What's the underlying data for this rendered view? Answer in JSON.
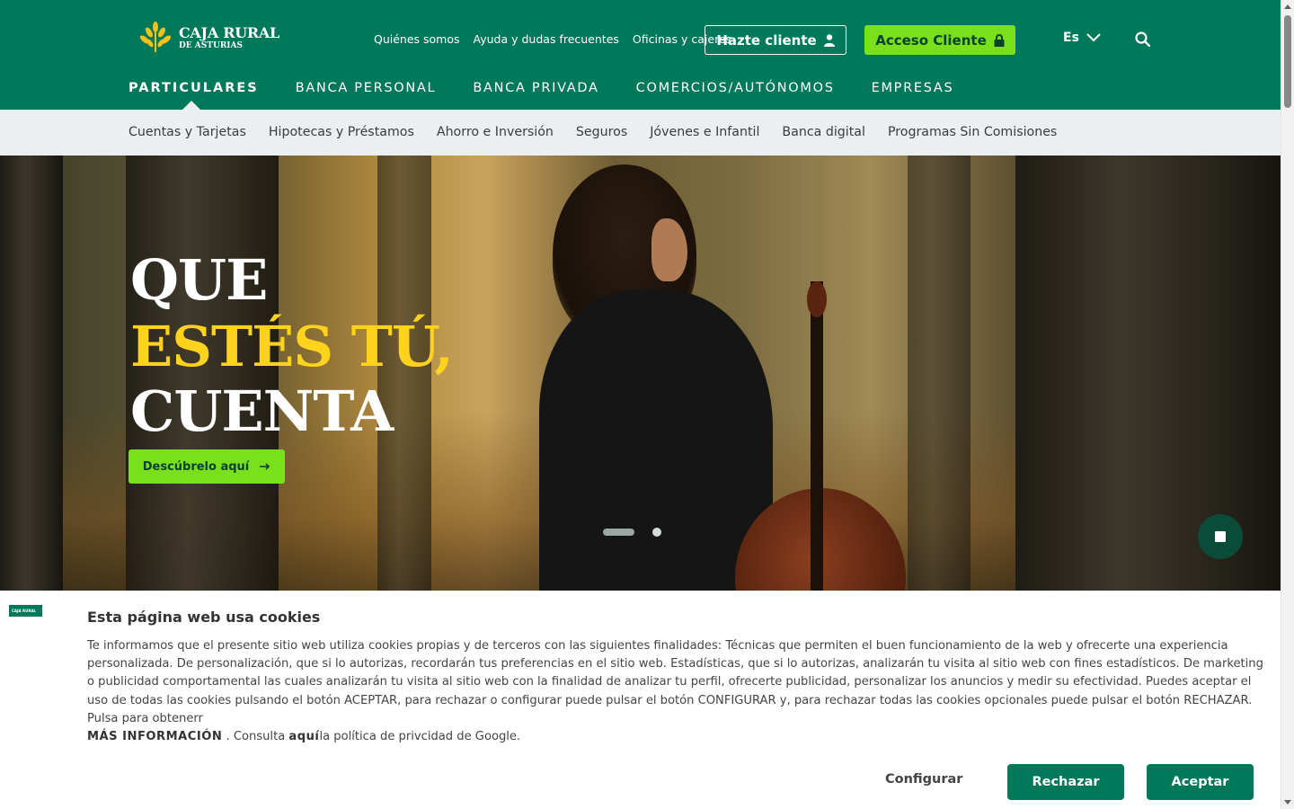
{
  "header": {
    "logo_line1": "CAJA RURAL",
    "logo_line2": "DE ASTURIAS",
    "toplinks": [
      "Quiénes somos",
      "Ayuda y dudas frecuentes",
      "Oficinas y cajeros"
    ],
    "hazte_cliente": "Hazte cliente",
    "acceso_cliente": "Acceso Cliente",
    "language": "Es",
    "brand_color": "#00785a",
    "accent_color": "#7ae01b"
  },
  "mainnav": {
    "items": [
      "PARTICULARES",
      "BANCA PERSONAL",
      "BANCA PRIVADA",
      "COMERCIOS/AUTÓNOMOS",
      "EMPRESAS"
    ],
    "active": "PARTICULARES"
  },
  "subnav": {
    "items": [
      "Cuentas y Tarjetas",
      "Hipotecas y Préstamos",
      "Ahorro e Inversión",
      "Seguros",
      "Jóvenes e Infantil",
      "Banca digital",
      "Programas Sin Comisiones"
    ]
  },
  "hero": {
    "line1": "QUE",
    "line2": "ESTÉS TÚ,",
    "line3": "CUENTA",
    "cta": "Descúbrelo aquí",
    "slides_total": 2,
    "active_slide": 1,
    "title_accent_color": "#ffd21e"
  },
  "cookie": {
    "title": "Esta página web usa cookies",
    "text": "Te informamos que el presente sitio web utiliza cookies propias y de terceros con las siguientes finalidades: Técnicas que permiten el buen funcionamiento de la web y ofrecerte una experiencia personalizada. De personalización, que si lo autorizas, recordarán tus preferencias en el sitio web. Estadísticas, que si lo autorizas, analizarán tu visita al sitio web con fines estadísticos. De marketing o publicidad comportamental las cuales analizarán tu visita al sitio web con la finalidad de analizar tu perfil, ofrecerte publicidad, personalizar los anuncios y medir su efectividad. Puedes aceptar el uso de todas las cookies pulsando el botón ACEPTAR, para rechazar o configurar puede pulsar el botón CONFIGURAR y, para rechazar todas las cookies opcionales puede pulsar el botón RECHAZAR. Pulsa para obtenerr",
    "mas_info": "MÁS INFORMACIÓN",
    "consulta": " . Consulta ",
    "aqui": "aquí",
    "google_policy": "la política de privcidad de Google.",
    "configurar": "Configurar",
    "rechazar": "Rechazar",
    "aceptar": "Aceptar"
  }
}
